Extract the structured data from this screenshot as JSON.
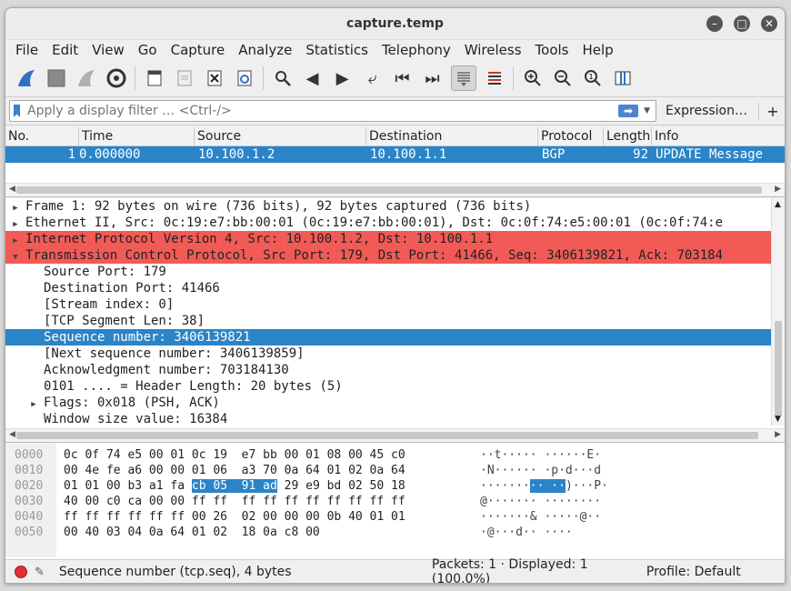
{
  "window": {
    "title": "capture.temp"
  },
  "menu": [
    "File",
    "Edit",
    "View",
    "Go",
    "Capture",
    "Analyze",
    "Statistics",
    "Telephony",
    "Wireless",
    "Tools",
    "Help"
  ],
  "filter": {
    "placeholder": "Apply a display filter … <Ctrl-/>",
    "expression_label": "Expression…",
    "plus": "+"
  },
  "packet_list": {
    "columns": [
      "No.",
      "Time",
      "Source",
      "Destination",
      "Protocol",
      "Length",
      "Info"
    ],
    "rows": [
      {
        "no": "1",
        "time": "0.000000",
        "source": "10.100.1.2",
        "destination": "10.100.1.1",
        "protocol": "BGP",
        "length": "92",
        "info": "UPDATE Message"
      }
    ]
  },
  "details": [
    "Frame 1: 92 bytes on wire (736 bits), 92 bytes captured (736 bits)",
    "Ethernet II, Src: 0c:19:e7:bb:00:01 (0c:19:e7:bb:00:01), Dst: 0c:0f:74:e5:00:01 (0c:0f:74:e",
    "Internet Protocol Version 4, Src: 10.100.1.2, Dst: 10.100.1.1",
    "Transmission Control Protocol, Src Port: 179, Dst Port: 41466, Seq: 3406139821, Ack: 703184",
    "Source Port: 179",
    "Destination Port: 41466",
    "[Stream index: 0]",
    "[TCP Segment Len: 38]",
    "Sequence number: 3406139821",
    "[Next sequence number: 3406139859]",
    "Acknowledgment number: 703184130",
    "0101 .... = Header Length: 20 bytes (5)",
    "Flags: 0x018 (PSH, ACK)",
    "Window size value: 16384"
  ],
  "bytes": {
    "offsets": [
      "0000",
      "0010",
      "0020",
      "0030",
      "0040",
      "0050"
    ],
    "hex": [
      "0c 0f 74 e5 00 01 0c 19  e7 bb 00 01 08 00 45 c0",
      "00 4e fe a6 00 00 01 06  a3 70 0a 64 01 02 0a 64",
      "01 01 00 b3 a1 fa ",
      "40 00 c0 ca 00 00 ff ff  ff ff ff ff ff ff ff ff",
      "ff ff ff ff ff ff 00 26  02 00 00 00 0b 40 01 01",
      "00 40 03 04 0a 64 01 02  18 0a c8 00"
    ],
    "hex_row2_highlight": "cb 05  91 ad",
    "hex_row2_tail": " 29 e9 bd 02 50 18",
    "ascii": [
      "··t····· ······E·",
      "·N······ ·p·d···d",
      "·······",
      "@······· ········",
      "·······& ·····@··",
      "·@···d·· ····"
    ],
    "ascii_row2_highlight": "·· ··",
    "ascii_row2_tail": ")···P·"
  },
  "status": {
    "field": "Sequence number (tcp.seq), 4 bytes",
    "packets": "Packets: 1 · Displayed: 1 (100.0%)",
    "profile": "Profile: Default"
  },
  "colors": {
    "selection": "#2b84c8",
    "highlight_red": "#f25a56"
  }
}
